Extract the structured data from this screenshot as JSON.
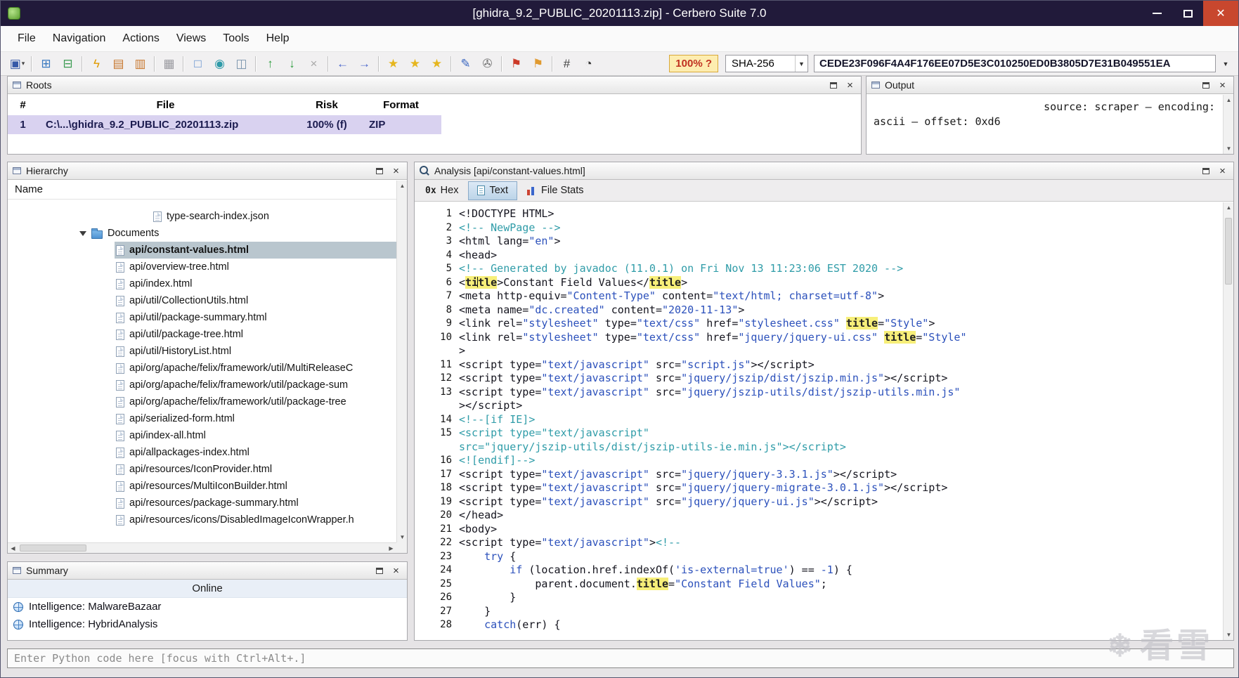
{
  "colors": {
    "titlebar_bg": "#211a3a",
    "close_bg": "#c8472e",
    "panel_hdr_from": "#fcfcfc",
    "panel_hdr_to": "#e7e7e7",
    "row_selected": "#d9d2f0",
    "tree_selected": "#b9c6ce",
    "highlight_bg": "#f7ef79",
    "code_plain": "#14141e",
    "code_string": "#2b50bb",
    "code_comment": "#2f9ca8",
    "code_keyword": "#2b50bb",
    "risk_bg": "#fdedb0",
    "risk_border": "#d8a83a",
    "risk_text": "#c03020"
  },
  "window": {
    "title": "[ghidra_9.2_PUBLIC_20201113.zip] - Cerbero Suite 7.0"
  },
  "menu": [
    "File",
    "Navigation",
    "Actions",
    "Views",
    "Tools",
    "Help"
  ],
  "toolbar": {
    "risk_label": "100% ?",
    "hash_algo": "SHA-256",
    "hash_value": "CEDE23F096F4A4F176EE07D5E3C010250ED0B3805D7E31B049551EA",
    "icons": [
      {
        "name": "save-icon",
        "glyph": "▣",
        "color": "#3558a8",
        "caret": true
      },
      {
        "sep": true
      },
      {
        "name": "export-workspace-icon",
        "glyph": "⊞",
        "color": "#3a7ac0"
      },
      {
        "name": "import-workspace-icon",
        "glyph": "⊟",
        "color": "#3a9a50"
      },
      {
        "sep": true
      },
      {
        "name": "scan-icon",
        "glyph": "ϟ",
        "color": "#e09a00"
      },
      {
        "name": "extract-files-icon",
        "glyph": "▤",
        "color": "#c87830"
      },
      {
        "name": "copy-special-icon",
        "glyph": "▥",
        "color": "#c87830"
      },
      {
        "sep": true
      },
      {
        "name": "paste-icon",
        "glyph": "▦",
        "color": "#9a9aa0"
      },
      {
        "sep": true
      },
      {
        "name": "select-range-icon",
        "glyph": "□",
        "color": "#5588cc"
      },
      {
        "name": "snapshot-icon",
        "glyph": "◉",
        "color": "#2e9aa8"
      },
      {
        "name": "select-block-icon",
        "glyph": "◫",
        "color": "#7a94ac"
      },
      {
        "sep": true
      },
      {
        "name": "find-previous-icon",
        "glyph": "↑",
        "color": "#2f9e3f"
      },
      {
        "name": "find-next-icon",
        "glyph": "↓",
        "color": "#2f9e3f"
      },
      {
        "name": "clear-results-icon",
        "glyph": "×",
        "color": "#a8a8a8"
      },
      {
        "sep": true
      },
      {
        "name": "back-icon",
        "glyph": "←",
        "color": "#4a66cc"
      },
      {
        "name": "forward-icon",
        "glyph": "→",
        "color": "#4a66cc"
      },
      {
        "sep": true
      },
      {
        "name": "bookmark-icon",
        "glyph": "★",
        "color": "#e6b61e"
      },
      {
        "name": "add-bookmark-icon",
        "glyph": "★",
        "color": "#e6b61e"
      },
      {
        "name": "bookmark-list-icon",
        "glyph": "★",
        "color": "#e6b61e"
      },
      {
        "sep": true
      },
      {
        "name": "edit-search-icon",
        "glyph": "✎",
        "color": "#3a66c0"
      },
      {
        "name": "attachments-icon",
        "glyph": "✇",
        "color": "#777777"
      },
      {
        "sep": true
      },
      {
        "name": "report-flag-icon",
        "glyph": "⚑",
        "color": "#cc3a28"
      },
      {
        "name": "format-flag-icon",
        "glyph": "⚑",
        "color": "#e09a30"
      },
      {
        "sep": true
      },
      {
        "name": "entropy-icon",
        "glyph": "#",
        "color": "#444444"
      },
      {
        "name": "history-icon",
        "glyph": "◔",
        "color": "#333333"
      }
    ]
  },
  "roots": {
    "title": "Roots",
    "columns": [
      "#",
      "File",
      "Risk",
      "Format"
    ],
    "row": {
      "num": "1",
      "file": "C:\\...\\ghidra_9.2_PUBLIC_20201113.zip",
      "risk": "100% (f)",
      "format": "ZIP"
    }
  },
  "output": {
    "title": "Output",
    "lines": [
      "source: scraper – encoding:",
      "ascii – offset: 0xd6"
    ]
  },
  "hierarchy": {
    "title": "Hierarchy",
    "column_header": "Name",
    "items": [
      {
        "label": "type-search-index.json",
        "indent": 2,
        "icon": "file"
      },
      {
        "label": "Documents",
        "indent": 0,
        "icon": "folder",
        "expanded": true
      },
      {
        "label": "api/constant-values.html",
        "indent": 1,
        "icon": "file",
        "selected": true
      },
      {
        "label": "api/overview-tree.html",
        "indent": 1,
        "icon": "file"
      },
      {
        "label": "api/index.html",
        "indent": 1,
        "icon": "file"
      },
      {
        "label": "api/util/CollectionUtils.html",
        "indent": 1,
        "icon": "file"
      },
      {
        "label": "api/util/package-summary.html",
        "indent": 1,
        "icon": "file"
      },
      {
        "label": "api/util/package-tree.html",
        "indent": 1,
        "icon": "file"
      },
      {
        "label": "api/util/HistoryList.html",
        "indent": 1,
        "icon": "file"
      },
      {
        "label": "api/org/apache/felix/framework/util/MultiReleaseC",
        "indent": 1,
        "icon": "file"
      },
      {
        "label": "api/org/apache/felix/framework/util/package-sum",
        "indent": 1,
        "icon": "file"
      },
      {
        "label": "api/org/apache/felix/framework/util/package-tree",
        "indent": 1,
        "icon": "file"
      },
      {
        "label": "api/serialized-form.html",
        "indent": 1,
        "icon": "file"
      },
      {
        "label": "api/index-all.html",
        "indent": 1,
        "icon": "file"
      },
      {
        "label": "api/allpackages-index.html",
        "indent": 1,
        "icon": "file"
      },
      {
        "label": "api/resources/IconProvider.html",
        "indent": 1,
        "icon": "file"
      },
      {
        "label": "api/resources/MultiIconBuilder.html",
        "indent": 1,
        "icon": "file"
      },
      {
        "label": "api/resources/package-summary.html",
        "indent": 1,
        "icon": "file"
      },
      {
        "label": "api/resources/icons/DisabledImageIconWrapper.h",
        "indent": 1,
        "icon": "file"
      }
    ]
  },
  "summary": {
    "title": "Summary",
    "online_label": "Online",
    "items": [
      "Intelligence: MalwareBazaar",
      "Intelligence: HybridAnalysis"
    ]
  },
  "analysis": {
    "title": "Analysis [api/constant-values.html]",
    "tabs": [
      {
        "id": "hex",
        "icon_text": "0x",
        "label": "Hex"
      },
      {
        "id": "text",
        "label": "Text",
        "selected": true
      },
      {
        "id": "stats",
        "label": "File Stats"
      }
    ],
    "lines": [
      {
        "n": "1",
        "seg": [
          [
            "p",
            "<!DOCTYPE HTML>"
          ]
        ]
      },
      {
        "n": "2",
        "seg": [
          [
            "c",
            "<!-- NewPage -->"
          ]
        ]
      },
      {
        "n": "3",
        "seg": [
          [
            "p",
            "<html lang="
          ],
          [
            "s",
            "\"en\""
          ],
          [
            "p",
            ">"
          ]
        ]
      },
      {
        "n": "4",
        "seg": [
          [
            "p",
            "<head>"
          ]
        ]
      },
      {
        "n": "5",
        "seg": [
          [
            "c",
            "<!-- Generated by javadoc (11.0.1) on Fri Nov 13 11:23:06 EST 2020 -->"
          ]
        ]
      },
      {
        "n": "6",
        "seg": [
          [
            "p",
            "<"
          ],
          [
            "h",
            "ti"
          ],
          [
            "cur",
            ""
          ],
          [
            "h",
            "tle"
          ],
          [
            "p",
            ">Constant Field Values</"
          ],
          [
            "h",
            "title"
          ],
          [
            "p",
            ">"
          ]
        ]
      },
      {
        "n": "7",
        "seg": [
          [
            "p",
            "<meta http-equiv="
          ],
          [
            "s",
            "\"Content-Type\""
          ],
          [
            "p",
            " content="
          ],
          [
            "s",
            "\"text/html; charset=utf-8\""
          ],
          [
            "p",
            ">"
          ]
        ]
      },
      {
        "n": "8",
        "seg": [
          [
            "p",
            "<meta name="
          ],
          [
            "s",
            "\"dc.created\""
          ],
          [
            "p",
            " content="
          ],
          [
            "s",
            "\"2020-11-13\""
          ],
          [
            "p",
            ">"
          ]
        ]
      },
      {
        "n": "9",
        "seg": [
          [
            "p",
            "<link rel="
          ],
          [
            "s",
            "\"stylesheet\""
          ],
          [
            "p",
            " type="
          ],
          [
            "s",
            "\"text/css\""
          ],
          [
            "p",
            " href="
          ],
          [
            "s",
            "\"stylesheet.css\""
          ],
          [
            "p",
            " "
          ],
          [
            "h",
            "title"
          ],
          [
            "p",
            "="
          ],
          [
            "s",
            "\"Style\""
          ],
          [
            "p",
            ">"
          ]
        ]
      },
      {
        "n": "10",
        "seg": [
          [
            "p",
            "<link rel="
          ],
          [
            "s",
            "\"stylesheet\""
          ],
          [
            "p",
            " type="
          ],
          [
            "s",
            "\"text/css\""
          ],
          [
            "p",
            " href="
          ],
          [
            "s",
            "\"jquery/jquery-ui.css\""
          ],
          [
            "p",
            " "
          ],
          [
            "h",
            "title"
          ],
          [
            "p",
            "="
          ],
          [
            "s",
            "\"Style\""
          ]
        ]
      },
      {
        "n": "",
        "seg": [
          [
            "p",
            ">"
          ]
        ]
      },
      {
        "n": "11",
        "seg": [
          [
            "p",
            "<script type="
          ],
          [
            "s",
            "\"text/javascript\""
          ],
          [
            "p",
            " src="
          ],
          [
            "s",
            "\"script.js\""
          ],
          [
            "p",
            "></script>"
          ]
        ]
      },
      {
        "n": "12",
        "seg": [
          [
            "p",
            "<script type="
          ],
          [
            "s",
            "\"text/javascript\""
          ],
          [
            "p",
            " src="
          ],
          [
            "s",
            "\"jquery/jszip/dist/jszip.min.js\""
          ],
          [
            "p",
            "></script>"
          ]
        ]
      },
      {
        "n": "13",
        "seg": [
          [
            "p",
            "<script type="
          ],
          [
            "s",
            "\"text/javascript\""
          ],
          [
            "p",
            " src="
          ],
          [
            "s",
            "\"jquery/jszip-utils/dist/jszip-utils.min.js\""
          ]
        ]
      },
      {
        "n": "",
        "seg": [
          [
            "p",
            "></script>"
          ]
        ]
      },
      {
        "n": "14",
        "seg": [
          [
            "c",
            "<!--[if IE]>"
          ]
        ]
      },
      {
        "n": "15",
        "seg": [
          [
            "c",
            "<script type=\"text/javascript\""
          ]
        ]
      },
      {
        "n": "",
        "seg": [
          [
            "c",
            "src=\"jquery/jszip-utils/dist/jszip-utils-ie.min.js\"></script>"
          ]
        ]
      },
      {
        "n": "16",
        "seg": [
          [
            "c",
            "<![endif]-->"
          ]
        ]
      },
      {
        "n": "17",
        "seg": [
          [
            "p",
            "<script type="
          ],
          [
            "s",
            "\"text/javascript\""
          ],
          [
            "p",
            " src="
          ],
          [
            "s",
            "\"jquery/jquery-3.3.1.js\""
          ],
          [
            "p",
            "></script>"
          ]
        ]
      },
      {
        "n": "18",
        "seg": [
          [
            "p",
            "<script type="
          ],
          [
            "s",
            "\"text/javascript\""
          ],
          [
            "p",
            " src="
          ],
          [
            "s",
            "\"jquery/jquery-migrate-3.0.1.js\""
          ],
          [
            "p",
            "></script>"
          ]
        ]
      },
      {
        "n": "19",
        "seg": [
          [
            "p",
            "<script type="
          ],
          [
            "s",
            "\"text/javascript\""
          ],
          [
            "p",
            " src="
          ],
          [
            "s",
            "\"jquery/jquery-ui.js\""
          ],
          [
            "p",
            "></script>"
          ]
        ]
      },
      {
        "n": "20",
        "seg": [
          [
            "p",
            "</head>"
          ]
        ]
      },
      {
        "n": "21",
        "seg": [
          [
            "p",
            "<body>"
          ]
        ]
      },
      {
        "n": "22",
        "seg": [
          [
            "p",
            "<script type="
          ],
          [
            "s",
            "\"text/javascript\""
          ],
          [
            "p",
            ">"
          ],
          [
            "c",
            "<!--"
          ]
        ]
      },
      {
        "n": "23",
        "seg": [
          [
            "p",
            "    "
          ],
          [
            "k",
            "try"
          ],
          [
            "p",
            " {"
          ]
        ]
      },
      {
        "n": "24",
        "seg": [
          [
            "p",
            "        "
          ],
          [
            "k",
            "if"
          ],
          [
            "p",
            " (location.href.indexOf("
          ],
          [
            "s",
            "'is-external=true'"
          ],
          [
            "p",
            ") == "
          ],
          [
            "s",
            "-1"
          ],
          [
            "p",
            ") {"
          ]
        ]
      },
      {
        "n": "25",
        "seg": [
          [
            "p",
            "            parent.document."
          ],
          [
            "h",
            "title"
          ],
          [
            "p",
            "="
          ],
          [
            "s",
            "\"Constant Field Values\""
          ],
          [
            "p",
            ";"
          ]
        ]
      },
      {
        "n": "26",
        "seg": [
          [
            "p",
            "        }"
          ]
        ]
      },
      {
        "n": "27",
        "seg": [
          [
            "p",
            "    }"
          ]
        ]
      },
      {
        "n": "28",
        "seg": [
          [
            "p",
            "    "
          ],
          [
            "k",
            "catch"
          ],
          [
            "p",
            "(err) {"
          ]
        ]
      }
    ]
  },
  "python": {
    "placeholder": "Enter Python code here [focus with Ctrl+Alt+.]"
  },
  "watermark": {
    "flake": "❄",
    "text": "看雪"
  }
}
